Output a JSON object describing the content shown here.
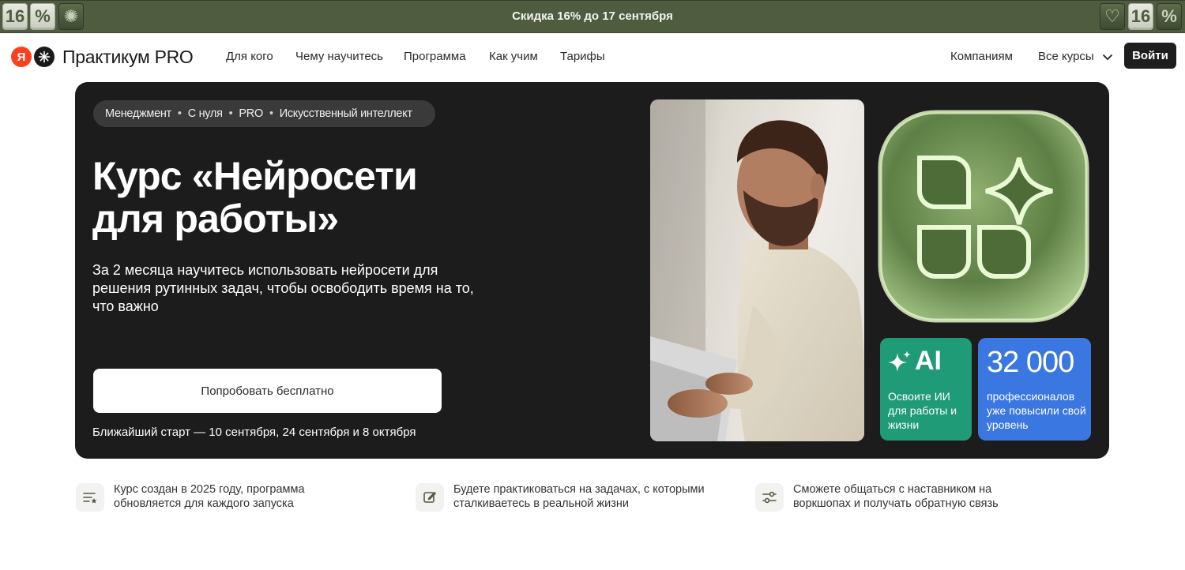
{
  "promo": {
    "text": "Скидка 16% до 17 сентября",
    "left_tiles": [
      "16",
      "%",
      "✺"
    ],
    "right_tiles": [
      "♡",
      "16",
      "%"
    ]
  },
  "header": {
    "logo_mark": "Я",
    "logo_text": "Практикум PRO",
    "nav": [
      "Для кого",
      "Чему научитесь",
      "Программа",
      "Как учим",
      "Тарифы"
    ],
    "companies": "Компаниям",
    "all_courses": "Все курсы",
    "login": "Войти"
  },
  "hero": {
    "tags": [
      "Менеджмент",
      "С нуля",
      "PRO",
      "Искусственный интеллект"
    ],
    "title_line1": "Курс «Нейросети",
    "title_line2": "для работы»",
    "subtitle": "За 2 месяца научитесь использовать нейросети для решения рутинных задач, чтобы освободить время на то, что важно",
    "cta": "Попробовать бесплатно",
    "start": "Ближайший старт — 10 сентября, 24 сентября и 8 октября",
    "card_ai": {
      "big": "AI",
      "text": "Освоите ИИ для работы и жизни",
      "color": "#1f9b78"
    },
    "card_stat": {
      "big": "32 000",
      "text": "профессионалов уже повысили свой уровень",
      "color": "#3a77e0"
    }
  },
  "features": [
    {
      "icon": "list-star-icon",
      "text": "Курс создан в 2025 году, программа обновляется для каждого запуска"
    },
    {
      "icon": "edit-icon",
      "text": "Будете практиковаться на задачах, с которыми сталкиваетесь в реальной жизни"
    },
    {
      "icon": "sliders-icon",
      "text": "Сможете общаться с наставником на воркшопах и получать обратную связь"
    }
  ]
}
